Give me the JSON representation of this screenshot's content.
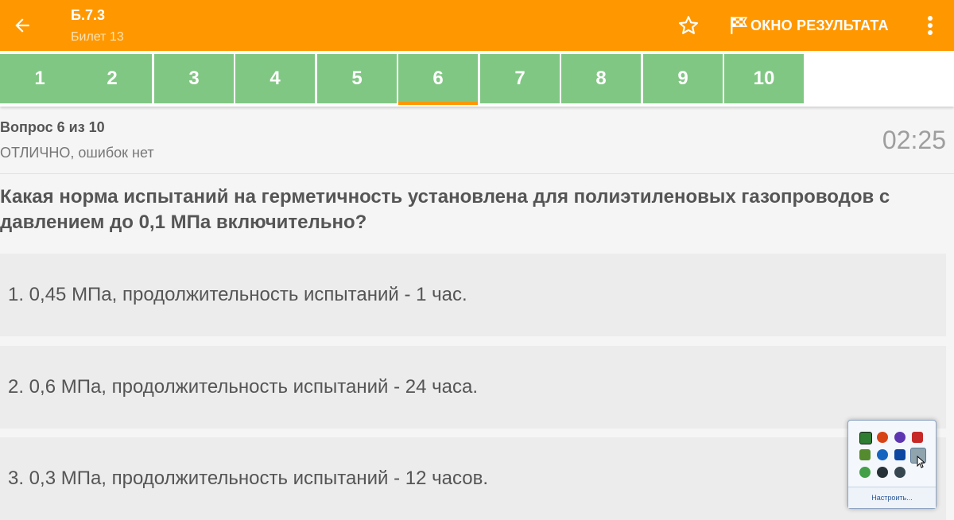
{
  "appbar": {
    "title": "Б.7.3",
    "subtitle": "Билет 13",
    "results_label": "ОКНО РЕЗУЛЬТАТА",
    "color": "#ff9800"
  },
  "tabs": [
    "1",
    "2",
    "3",
    "4",
    "5",
    "6",
    "7",
    "8",
    "9",
    "10"
  ],
  "active_tab": "6",
  "tab_color": "#81c784",
  "info": {
    "counter": "Вопрос 6 из 10",
    "status": "ОТЛИЧНО, ошибок нет",
    "timer": "02:25"
  },
  "question": "Какая норма испытаний на герметичность установлена для полиэтиленовых газопроводов с давлением до 0,1 МПа включительно?",
  "answers": [
    "1. 0,45 МПа, продолжительность испытаний - 1 час.",
    "2. 0,6 МПа, продолжительность испытаний - 24 часа.",
    "3. 0,3 МПа, продолжительность испытаний - 12 часов."
  ],
  "tray": {
    "footer": "Настроить...",
    "icons": [
      "nvidia-icon",
      "ccleaner-icon",
      "vpn-icon",
      "network-icon",
      "usb-icon",
      "bluetooth-icon",
      "app-3d-icon",
      "display-icon",
      "update-icon",
      "app-dark-icon",
      "app-dark-icon-2"
    ]
  }
}
